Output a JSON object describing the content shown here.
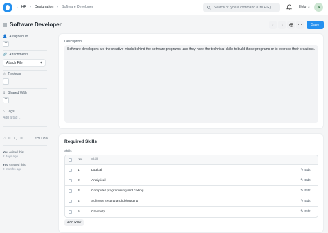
{
  "navbar": {
    "breadcrumbs": [
      "HR",
      "Designation",
      "Software Developer"
    ],
    "search_placeholder": "Search or type a command (Ctrl + G)",
    "help_label": "Help",
    "avatar_initial": "A"
  },
  "header": {
    "title": "Software Developer",
    "save_label": "Save"
  },
  "sidebar": {
    "assigned_to": "Assigned To",
    "attachments": "Attachments",
    "attach_file": "Attach File",
    "reviews": "Reviews",
    "shared_with": "Shared With",
    "tags": "Tags",
    "add_tag": "Add a tag ...",
    "likes": "0",
    "comments": "0",
    "follow": "FOLLOW",
    "activity": [
      {
        "who": "You",
        "action": " edited this",
        "when": "2 days ago"
      },
      {
        "who": "You",
        "action": " created this",
        "when": "2 months ago"
      }
    ]
  },
  "description": {
    "label": "Description",
    "text": "Software developers are the creative minds behind the software programs, and they have the technical skills to build those programs or to oversee their creations."
  },
  "skills": {
    "section_title": "Required Skills",
    "field_label": "Skills",
    "columns": {
      "no": "No.",
      "skill": "Skill"
    },
    "edit_label": "Edit",
    "add_row": "Add Row",
    "rows": [
      {
        "no": "1",
        "skill": "Logical"
      },
      {
        "no": "2",
        "skill": "Analytical"
      },
      {
        "no": "3",
        "skill": "Computer programming and coding"
      },
      {
        "no": "4",
        "skill": "Software testing and debugging"
      },
      {
        "no": "5",
        "skill": "Creativity"
      }
    ]
  },
  "colors": {
    "accent": "#2490ef",
    "background": "#f4f5f6"
  }
}
